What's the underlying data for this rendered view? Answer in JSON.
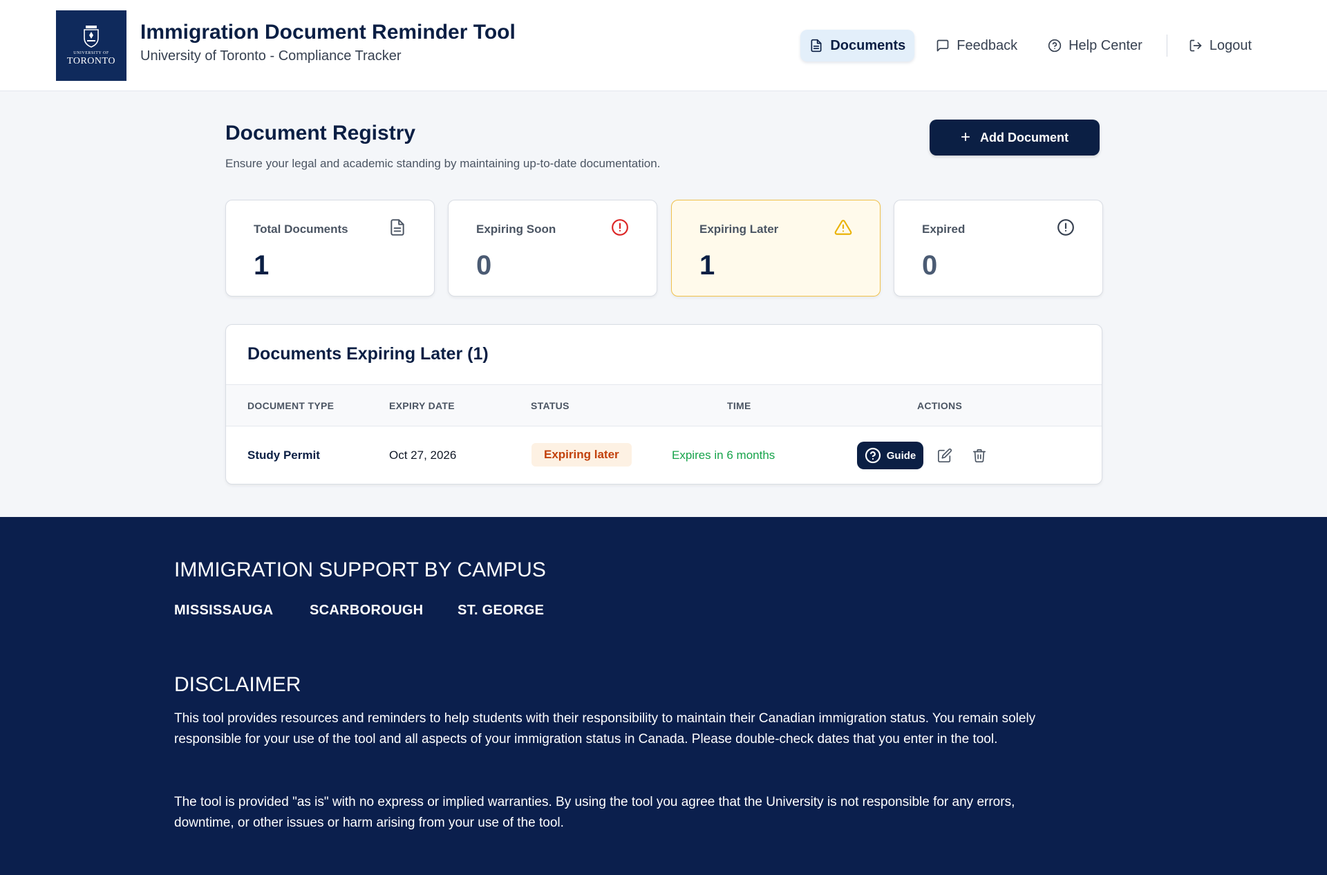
{
  "header": {
    "logo_small": "UNIVERSITY OF",
    "logo_big": "TORONTO",
    "title": "Immigration Document Reminder Tool",
    "subtitle": "University of Toronto - Compliance Tracker",
    "nav": [
      {
        "label": "Documents",
        "icon": "document-icon",
        "active": true
      },
      {
        "label": "Feedback",
        "icon": "chat-icon"
      },
      {
        "label": "Help Center",
        "icon": "help-circle-icon"
      },
      {
        "label": "Logout",
        "icon": "logout-icon"
      }
    ]
  },
  "main": {
    "title": "Document Registry",
    "description": "Ensure your legal and academic standing by maintaining up-to-date documentation.",
    "add_button": "Add Document",
    "cards": [
      {
        "label": "Total Documents",
        "value": "1",
        "icon": "document-icon",
        "color": "#0b1f44"
      },
      {
        "label": "Expiring Soon",
        "value": "0",
        "icon": "alert-circle-icon",
        "color": "#4b5b73",
        "icon_color": "#dc2626"
      },
      {
        "label": "Expiring Later",
        "value": "1",
        "icon": "warning-triangle-icon",
        "color": "#0b1f44",
        "icon_color": "#eab308"
      },
      {
        "label": "Expired",
        "value": "0",
        "icon": "alert-circle-icon",
        "color": "#4b5b73",
        "icon_color": "#374151"
      }
    ],
    "table": {
      "title": "Documents Expiring Later (1)",
      "columns": [
        "DOCUMENT TYPE",
        "EXPIRY DATE",
        "STATUS",
        "TIME",
        "ACTIONS"
      ],
      "rows": [
        {
          "document_type": "Study Permit",
          "expiry_date": "Oct 27, 2026",
          "status": "Expiring later",
          "time": "Expires in 6 months",
          "guide_label": "Guide"
        }
      ]
    }
  },
  "footer": {
    "support_heading": "IMMIGRATION SUPPORT BY CAMPUS",
    "campuses": [
      "MISSISSAUGA",
      "SCARBOROUGH",
      "ST. GEORGE"
    ],
    "disclaimer_heading": "DISCLAIMER",
    "disclaimer_paragraphs": [
      "This tool provides resources and reminders to help students with their responsibility to maintain their Canadian immigration status. You remain solely responsible for your use of the tool and all aspects of your immigration status in Canada. Please double-check dates that you enter in the tool.",
      "The tool is provided \"as is\" with no express or implied warranties. By using the tool you agree that the University is not responsible for any errors, downtime, or other issues or harm arising from your use of the tool."
    ]
  }
}
